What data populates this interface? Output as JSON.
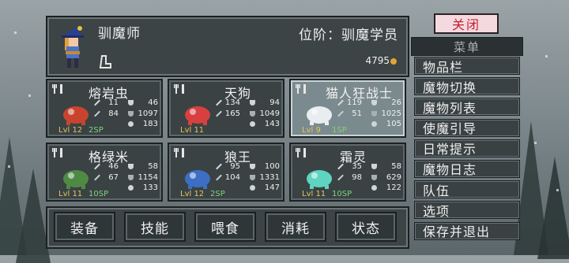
{
  "profile": {
    "name": "驯魔师",
    "rank": "位阶：驯魔学员",
    "gold": "4795"
  },
  "monsters": [
    {
      "name": "熔岩虫",
      "atk": "11",
      "def": "46",
      "mag": "84",
      "mdef": "1097",
      "lvl": "Lvl 12",
      "sp": "2SP",
      "hp": "183",
      "color": "#c9442e"
    },
    {
      "name": "天狗",
      "atk": "134",
      "def": "94",
      "mag": "165",
      "mdef": "1049",
      "lvl": "Lvl 11",
      "sp": "",
      "hp": "143",
      "color": "#d84040"
    },
    {
      "name": "猫人狂战士",
      "atk": "119",
      "def": "26",
      "mag": "51",
      "mdef": "1025",
      "lvl": "Lvl 9",
      "sp": "1SP",
      "hp": "105",
      "color": "#e8eef0"
    },
    {
      "name": "格绿米",
      "atk": "46",
      "def": "58",
      "mag": "67",
      "mdef": "1154",
      "lvl": "Lvl 11",
      "sp": "10SP",
      "hp": "133",
      "color": "#4f8a45"
    },
    {
      "name": "狼王",
      "atk": "95",
      "def": "100",
      "mag": "104",
      "mdef": "1331",
      "lvl": "Lvl 12",
      "sp": "2SP",
      "hp": "147",
      "color": "#3c6fc4"
    },
    {
      "name": "霜灵",
      "atk": "35",
      "def": "58",
      "mag": "98",
      "mdef": "629",
      "lvl": "Lvl 11",
      "sp": "10SP",
      "hp": "122",
      "color": "#5fd4c0"
    }
  ],
  "tabs": [
    "装备",
    "技能",
    "喂食",
    "消耗",
    "状态"
  ],
  "close_label": "关闭",
  "menu_title": "菜单",
  "menu_items": [
    "物品栏",
    "魔物切换",
    "魔物列表",
    "使魔引导",
    "日常提示",
    "魔物日志",
    "队伍",
    "选项",
    "保存并退出"
  ],
  "colors": {
    "level": "#e2c65a",
    "sp": "#7fd37a",
    "gold": "#e3a530",
    "close_text": "#c41f2f"
  }
}
